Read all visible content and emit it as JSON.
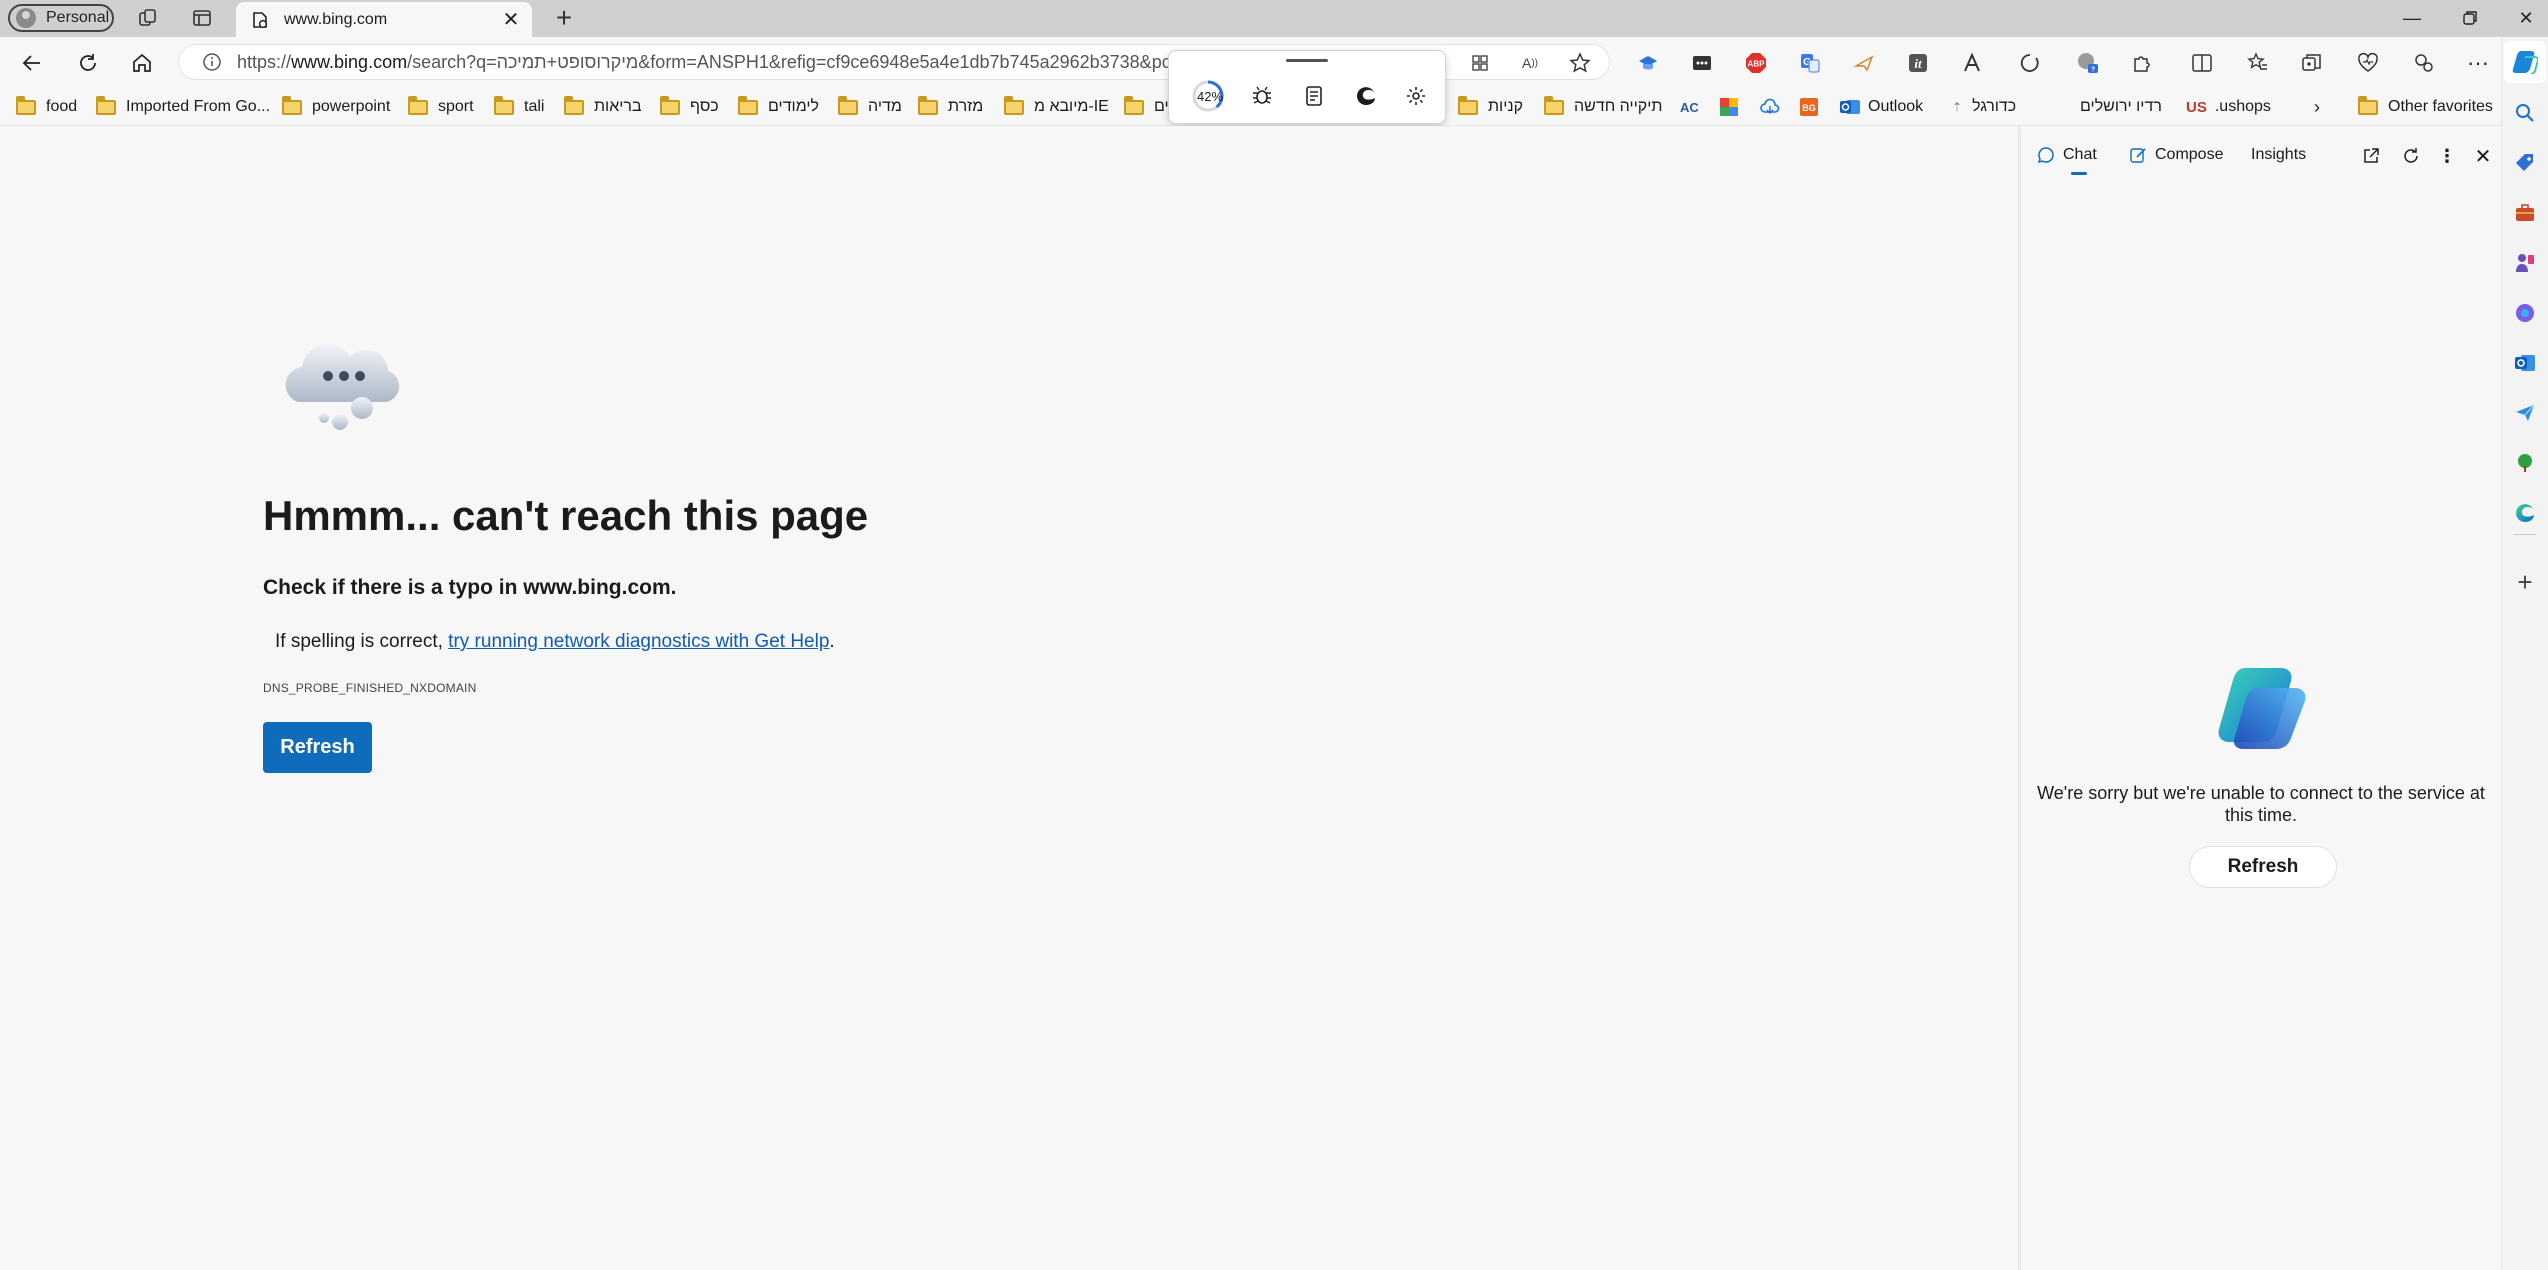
{
  "profile": {
    "label": "Personal"
  },
  "tab": {
    "title": "www.bing.com"
  },
  "address": {
    "url_prefix": "https://",
    "url_host": "www.bing.com",
    "url_rest": "/search?q=מיקרוסופט+תמיכה&form=ANSPH1&refig=cf9ce6948e5a4e1db7b745a2962b3738&pc="
  },
  "favorites": [
    {
      "label": "food"
    },
    {
      "label": "Imported From Go..."
    },
    {
      "label": "powerpoint"
    },
    {
      "label": "sport"
    },
    {
      "label": "tali"
    },
    {
      "label": "בריאות"
    },
    {
      "label": "כסף"
    },
    {
      "label": "לימודים"
    },
    {
      "label": "מדיה"
    },
    {
      "label": "מזרת"
    },
    {
      "label": "מיובא מ-IE"
    },
    {
      "label": "ים"
    },
    {
      "label": "קניות"
    },
    {
      "label": "תיקייה חדשה"
    },
    {
      "label": "Outlook"
    },
    {
      "label": "כדורגל"
    },
    {
      "label": "רדיו ירושלים"
    },
    {
      "label": ".ushops"
    },
    {
      "label": "Other favorites"
    }
  ],
  "floatbar": {
    "zoom": "42%"
  },
  "error": {
    "title": "Hmmm... can't reach this page",
    "subtitle": "Check if there is a typo in www.bing.com.",
    "hint_prefix": "If spelling is correct, ",
    "hint_link": "try running network diagnostics with Get Help",
    "hint_suffix": ".",
    "code": "DNS_PROBE_FINISHED_NXDOMAIN",
    "refresh_label": "Refresh"
  },
  "panel": {
    "tabs": [
      {
        "label": "Chat"
      },
      {
        "label": "Compose"
      },
      {
        "label": "Insights"
      }
    ],
    "message": "We're sorry but we're unable to connect to the service at this time.",
    "refresh_label": "Refresh"
  },
  "colors": {
    "accent": "#0f6cbd",
    "link": "#0e5bb5",
    "page_bg": "#f7f7f7",
    "tabbar_bg": "#cfcfcf"
  }
}
